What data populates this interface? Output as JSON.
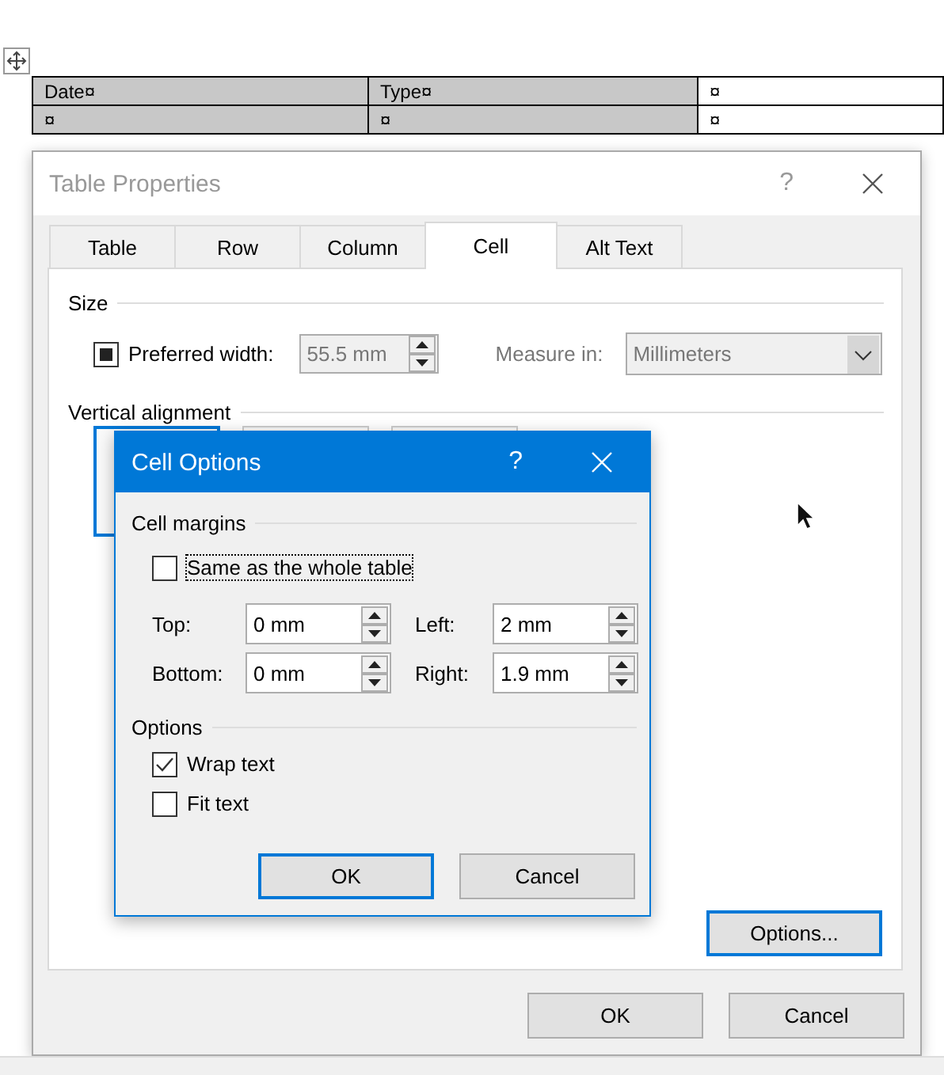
{
  "document_table": {
    "rows": [
      [
        {
          "text": "Date¤",
          "shaded": true
        },
        {
          "text": "Type¤",
          "shaded": true
        },
        {
          "text": "¤",
          "shaded": false
        }
      ],
      [
        {
          "text": "¤",
          "shaded": true
        },
        {
          "text": "¤",
          "shaded": true
        },
        {
          "text": "¤",
          "shaded": false
        }
      ]
    ]
  },
  "table_properties": {
    "title": "Table Properties",
    "help": "?",
    "tabs": [
      {
        "label": "Table",
        "selected": false
      },
      {
        "label": "Row",
        "selected": false
      },
      {
        "label": "Column",
        "selected": false
      },
      {
        "label": "Cell",
        "selected": true
      },
      {
        "label": "Alt Text",
        "selected": false
      }
    ],
    "size": {
      "title": "Size",
      "preferred_width": {
        "label": "Preferred width:",
        "checked": true,
        "value": "55.5 mm",
        "disabled": true
      },
      "measure_in": {
        "label": "Measure in:",
        "value": "Millimeters",
        "disabled": true
      }
    },
    "vertical_alignment": {
      "title": "Vertical alignment"
    },
    "options_button": {
      "label": "Options...",
      "focused": true
    },
    "buttons": [
      {
        "label": "OK"
      },
      {
        "label": "Cancel"
      }
    ]
  },
  "cell_options": {
    "title": "Cell Options",
    "help": "?",
    "cell_margins": {
      "title": "Cell margins",
      "same_as_whole_table": {
        "label": "Same as the whole table",
        "checked": false,
        "focused": true
      },
      "margins": [
        {
          "label": "Top:",
          "value": "0 mm"
        },
        {
          "label": "Left:",
          "value": "2 mm"
        },
        {
          "label": "Bottom:",
          "value": "0 mm"
        },
        {
          "label": "Right:",
          "value": "1.9 mm"
        }
      ]
    },
    "options": {
      "title": "Options",
      "checkboxes": [
        {
          "label": "Wrap text",
          "checked": true
        },
        {
          "label": "Fit text",
          "checked": false
        }
      ]
    },
    "buttons": [
      {
        "label": "OK",
        "default": true
      },
      {
        "label": "Cancel",
        "default": false
      }
    ]
  }
}
